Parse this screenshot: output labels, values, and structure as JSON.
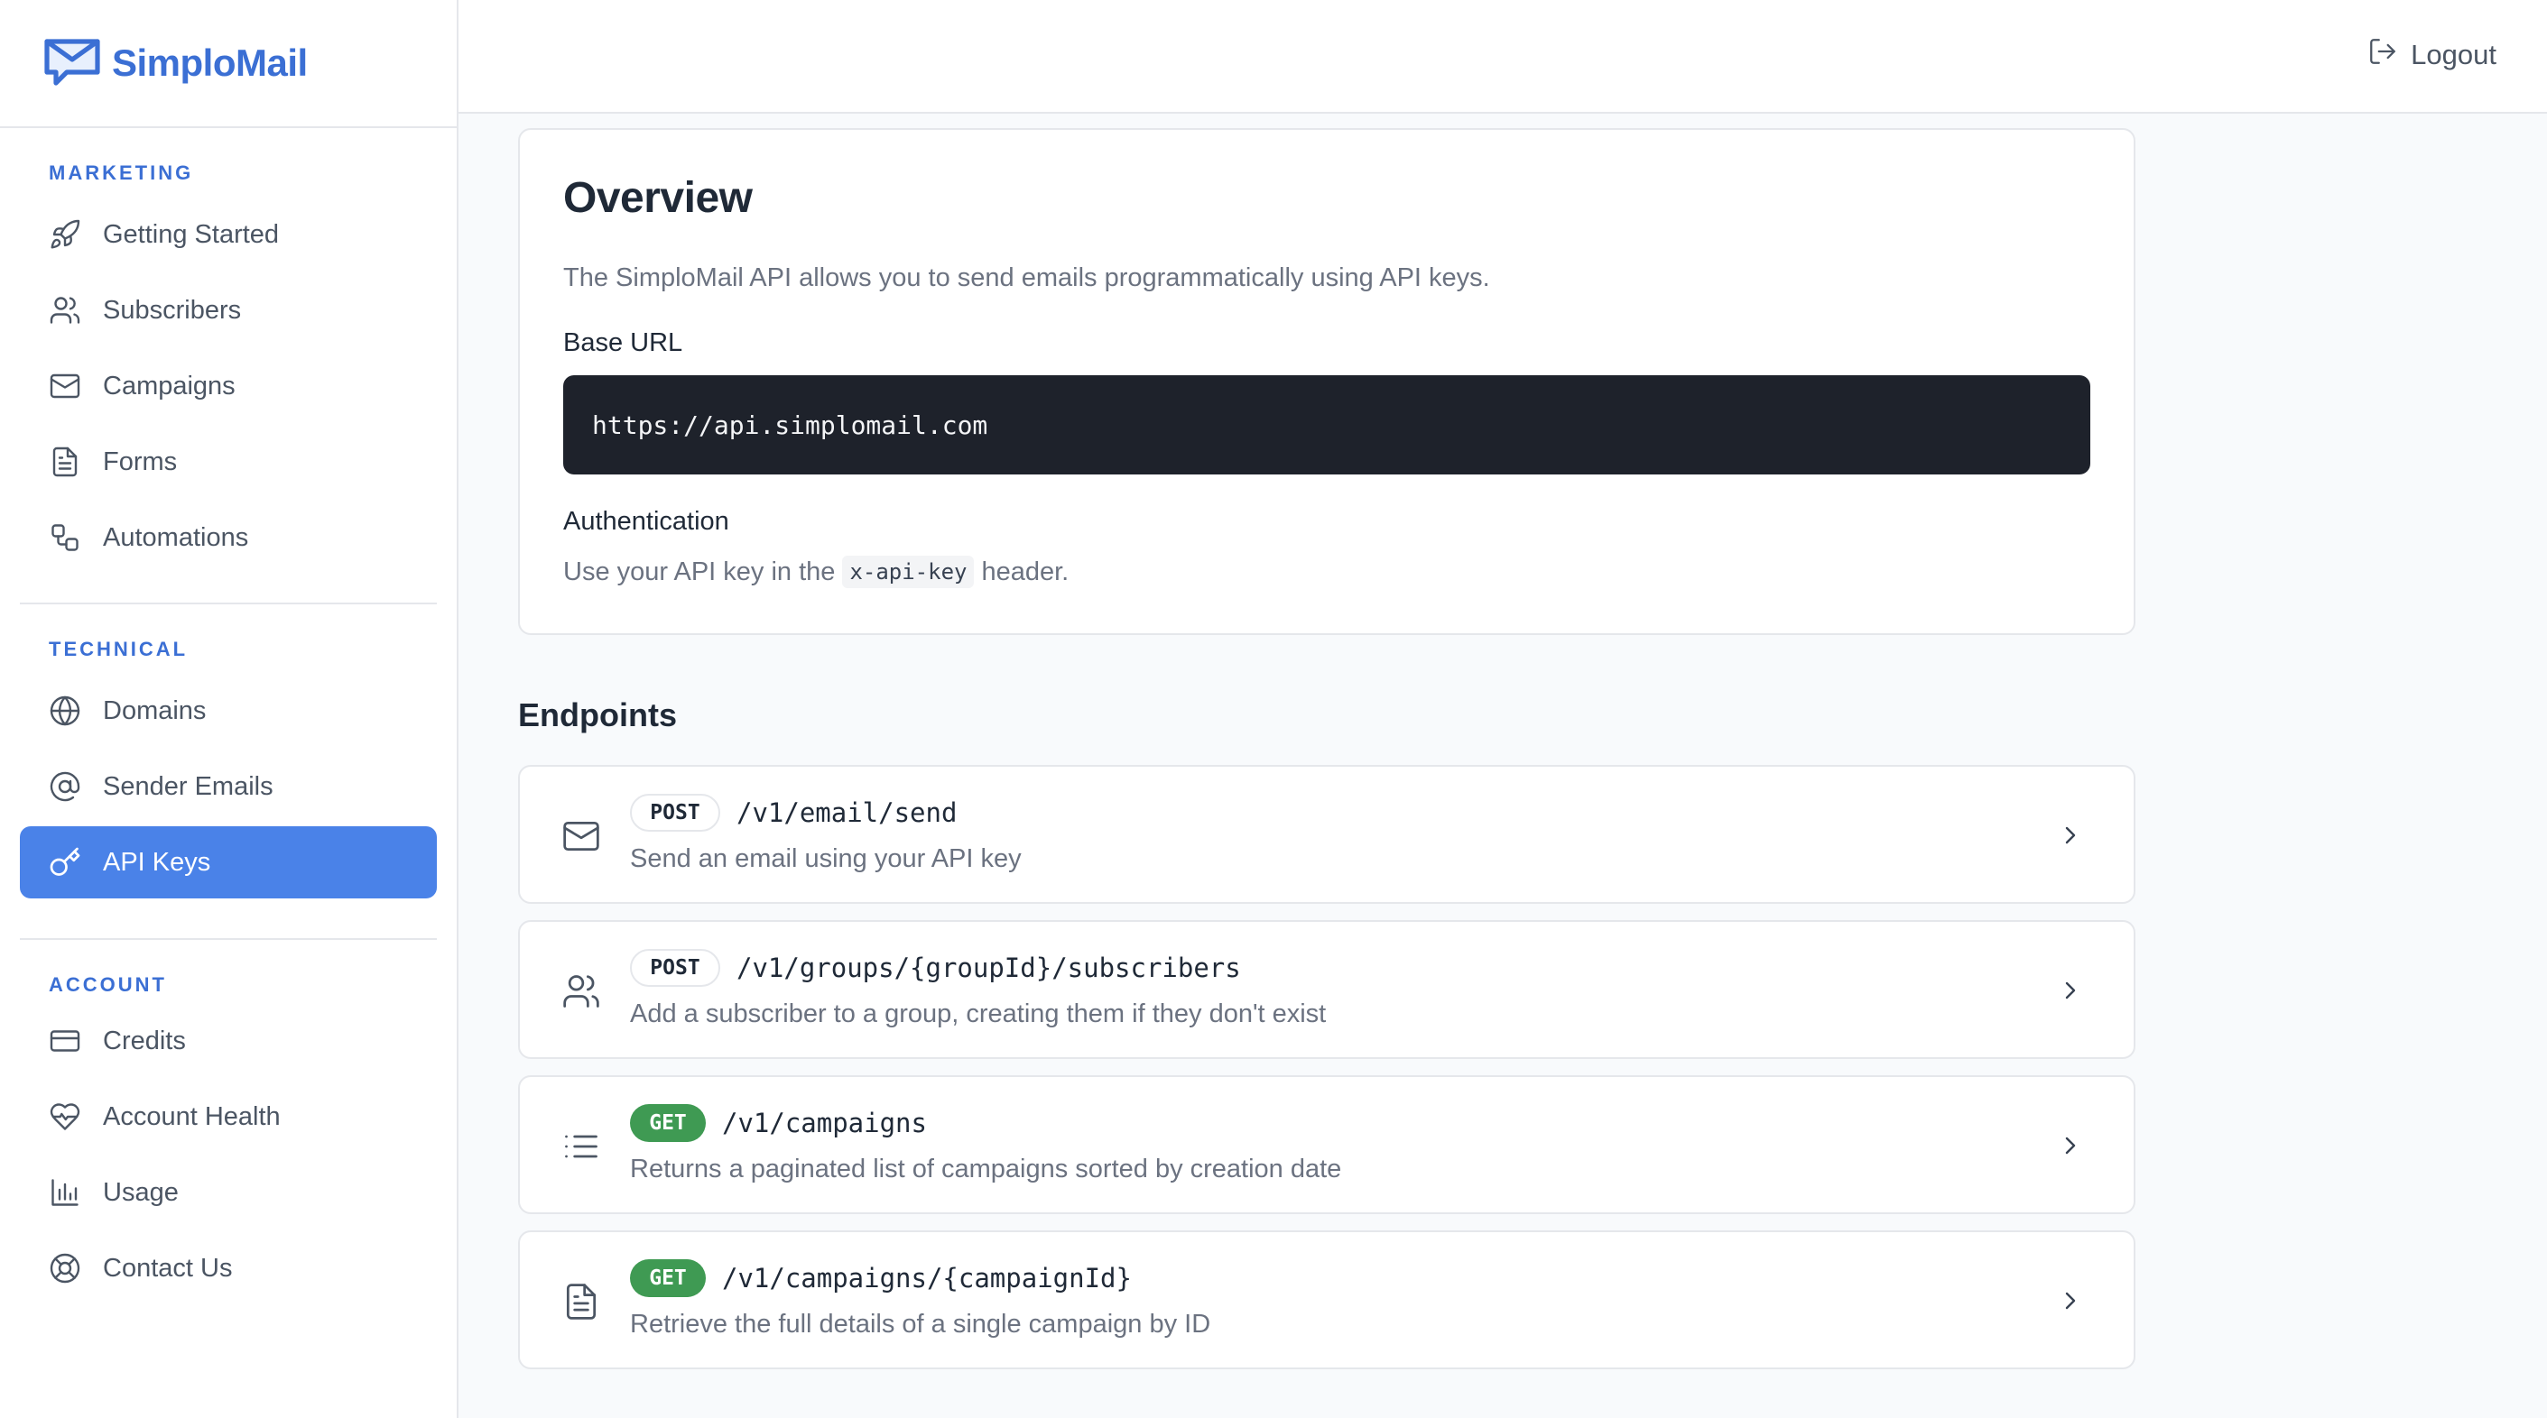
{
  "brand": {
    "name": "SimploMail"
  },
  "header": {
    "logout_label": "Logout"
  },
  "sidebar": {
    "sections": [
      {
        "title": "MARKETING",
        "items": [
          {
            "label": "Getting Started",
            "icon": "rocket-icon"
          },
          {
            "label": "Subscribers",
            "icon": "users-icon"
          },
          {
            "label": "Campaigns",
            "icon": "mail-icon"
          },
          {
            "label": "Forms",
            "icon": "file-text-icon"
          },
          {
            "label": "Automations",
            "icon": "workflow-icon"
          }
        ]
      },
      {
        "title": "TECHNICAL",
        "items": [
          {
            "label": "Domains",
            "icon": "globe-icon"
          },
          {
            "label": "Sender Emails",
            "icon": "at-sign-icon"
          },
          {
            "label": "API Keys",
            "icon": "key-icon",
            "active": true
          }
        ]
      },
      {
        "title": "ACCOUNT",
        "items": [
          {
            "label": "Credits",
            "icon": "credit-card-icon"
          },
          {
            "label": "Account Health",
            "icon": "heart-pulse-icon"
          },
          {
            "label": "Usage",
            "icon": "bar-chart-icon"
          },
          {
            "label": "Contact Us",
            "icon": "life-buoy-icon"
          }
        ]
      }
    ]
  },
  "overview": {
    "title": "Overview",
    "description": "The SimploMail API allows you to send emails programmatically using API keys.",
    "base_url_label": "Base URL",
    "base_url": "https://api.simplomail.com",
    "auth_label": "Authentication",
    "auth_text_before": "Use your API key in the",
    "auth_code": "x-api-key",
    "auth_text_after": "header."
  },
  "endpoints": {
    "title": "Endpoints",
    "items": [
      {
        "method": "POST",
        "path": "/v1/email/send",
        "description": "Send an email using your API key",
        "icon": "mail-icon"
      },
      {
        "method": "POST",
        "path": "/v1/groups/{groupId}/subscribers",
        "description": "Add a subscriber to a group, creating them if they don't exist",
        "icon": "users-icon"
      },
      {
        "method": "GET",
        "path": "/v1/campaigns",
        "description": "Returns a paginated list of campaigns sorted by creation date",
        "icon": "list-icon"
      },
      {
        "method": "GET",
        "path": "/v1/campaigns/{campaignId}",
        "description": "Retrieve the full details of a single campaign by ID",
        "icon": "file-text-icon"
      }
    ]
  },
  "colors": {
    "accent": "#4a82e8",
    "brand": "#3b6fd4",
    "get_badge": "#3f9a53",
    "code_bg": "#1e222b"
  }
}
